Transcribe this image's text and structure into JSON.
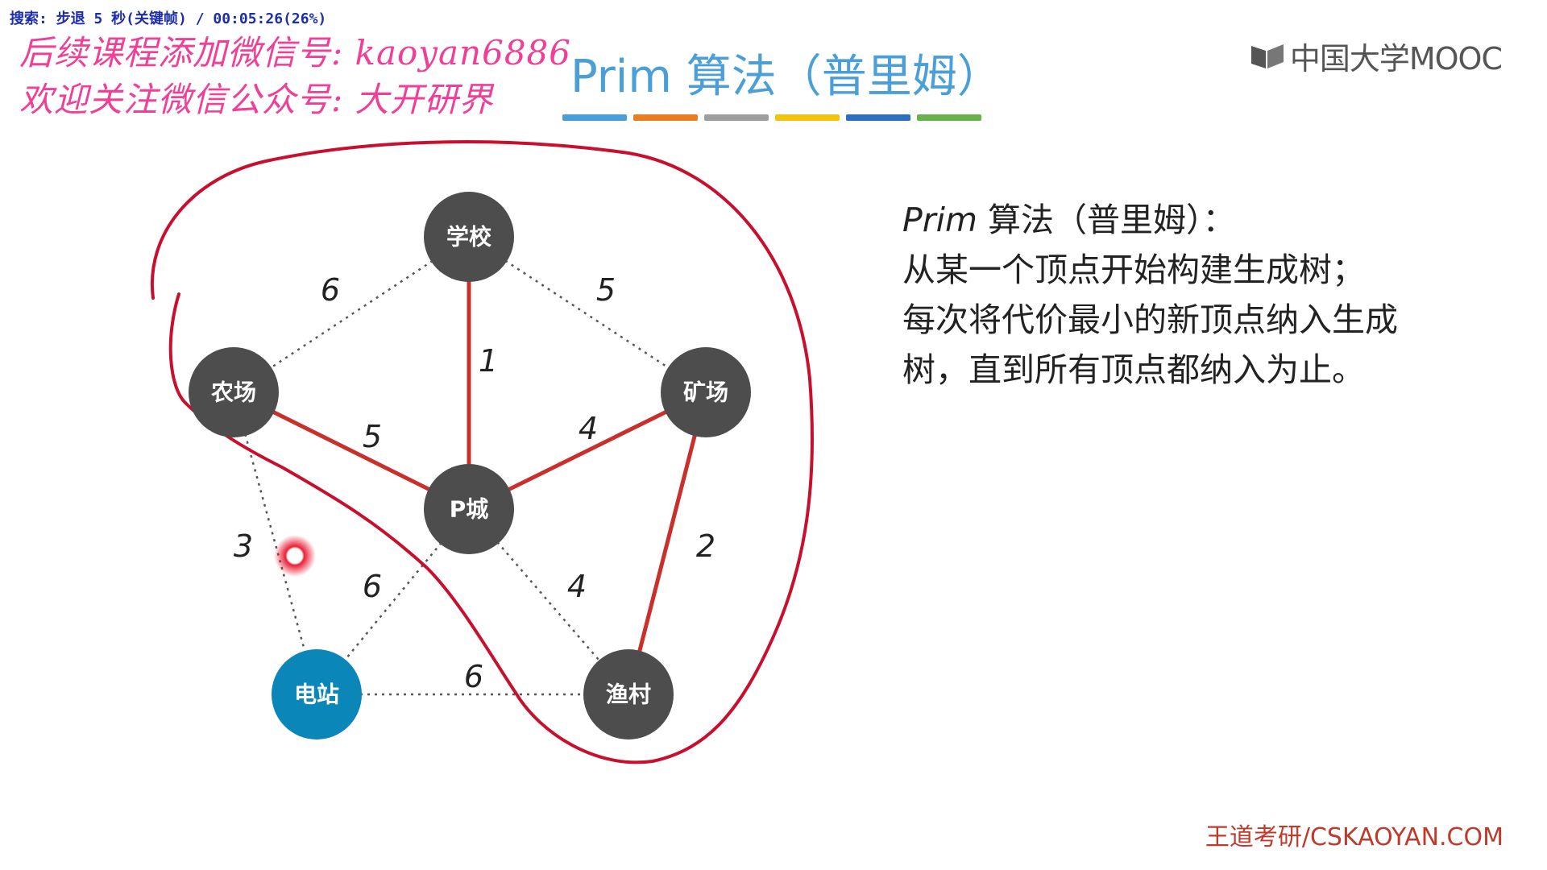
{
  "player": {
    "status_text": "搜索: 步退 5 秒(关键帧) / 00:05:26(26%)"
  },
  "watermark": {
    "line1": "后续课程添加微信号: kaoyan6886",
    "line2": "欢迎关注微信公众号: 大开研界"
  },
  "slide": {
    "title": "Prim 算法（普里姆）",
    "brand": "中国大学MOOC",
    "footer": "王道考研/CSKAOYAN.COM",
    "description": {
      "line1_italic": "Prim",
      "line1_rest": " 算法（普里姆）：",
      "line2": "从某一个顶点开始构建生成树；",
      "line3": "每次将代价最小的新顶点纳入生成",
      "line4": "树，直到所有顶点都纳入为止。"
    },
    "title_bar_colors": [
      "#4a9fd8",
      "#e67e22",
      "#9e9e9e",
      "#f1c40f",
      "#2e6fbf",
      "#6ab04c"
    ]
  },
  "colors": {
    "node_dark": "#4d4d4d",
    "node_highlight": "#0a86b8",
    "tree_edge": "#c9302c",
    "dotted_edge": "#555555",
    "annotation_stroke": "#c8102e",
    "cursor_glow": "#e8142b"
  },
  "graph": {
    "nodes": [
      {
        "id": "school",
        "label": "学校",
        "highlight": false
      },
      {
        "id": "farm",
        "label": "农场",
        "highlight": false
      },
      {
        "id": "mine",
        "label": "矿场",
        "highlight": false
      },
      {
        "id": "pcity",
        "label": "P城",
        "highlight": false
      },
      {
        "id": "station",
        "label": "电站",
        "highlight": true
      },
      {
        "id": "village",
        "label": "渔村",
        "highlight": false
      }
    ],
    "edges": [
      {
        "from": "school",
        "to": "farm",
        "weight": "6",
        "in_tree": false
      },
      {
        "from": "school",
        "to": "mine",
        "weight": "5",
        "in_tree": false
      },
      {
        "from": "school",
        "to": "pcity",
        "weight": "1",
        "in_tree": true
      },
      {
        "from": "farm",
        "to": "pcity",
        "weight": "5",
        "in_tree": true
      },
      {
        "from": "mine",
        "to": "pcity",
        "weight": "4",
        "in_tree": true
      },
      {
        "from": "farm",
        "to": "station",
        "weight": "3",
        "in_tree": false
      },
      {
        "from": "pcity",
        "to": "station",
        "weight": "6",
        "in_tree": false
      },
      {
        "from": "pcity",
        "to": "village",
        "weight": "4",
        "in_tree": false
      },
      {
        "from": "mine",
        "to": "village",
        "weight": "2",
        "in_tree": true
      },
      {
        "from": "station",
        "to": "village",
        "weight": "6",
        "in_tree": false
      }
    ]
  }
}
